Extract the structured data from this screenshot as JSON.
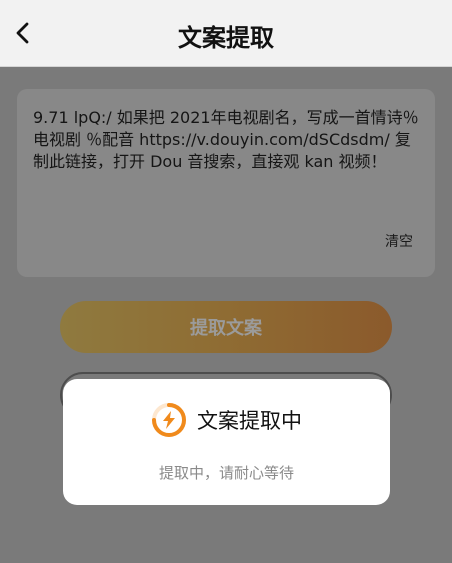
{
  "header": {
    "back_icon": "chevron-left-icon",
    "title": "文案提取"
  },
  "input_card": {
    "text": "9.71 lpQ:/ 如果把 2021年电视剧名，写成一首情诗％电视剧 ％配音   https://v.douyin.com/dSCdsdm/ 复制此链接，打开 Dou 音搜索，直接观 kan 视频！",
    "clear_label": "清空"
  },
  "actions": {
    "extract_label": "提取文案"
  },
  "loading_modal": {
    "icon": "lightning-spinner-icon",
    "title": "文案提取中",
    "subtitle": "提取中，请耐心等待",
    "accent_color": "#f08a1c"
  }
}
